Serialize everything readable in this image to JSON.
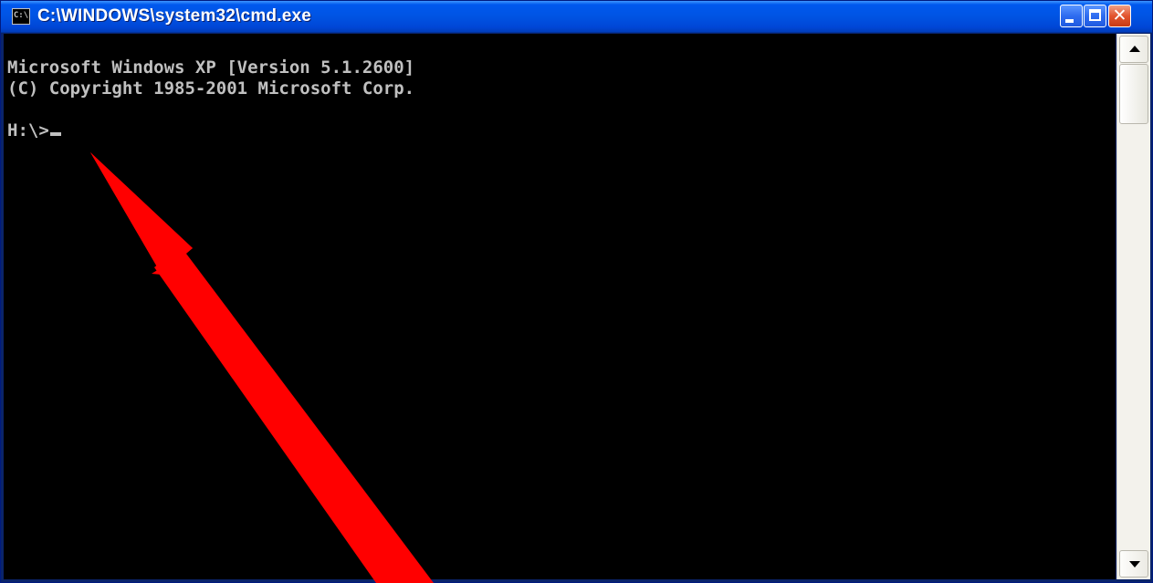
{
  "window": {
    "title": "C:\\WINDOWS\\system32\\cmd.exe",
    "icon_label": "C:\\"
  },
  "console": {
    "lines": [
      "Microsoft Windows XP [Version 5.1.2600]",
      "(C) Copyright 1985-2001 Microsoft Corp.",
      "H:\\>"
    ]
  },
  "colors": {
    "titlebar": "#0054e3",
    "console_bg": "#000000",
    "console_text": "#c0c0c0",
    "close_button": "#e2542e",
    "annotation_arrow": "#ff0000"
  },
  "icons": {
    "window_icon": "cmd-icon",
    "minimize": "minimize-icon",
    "maximize": "maximize-icon",
    "close": "close-icon",
    "scroll_up": "arrow-up-icon",
    "scroll_down": "arrow-down-icon",
    "annotation": "red-arrow-icon"
  },
  "scrollbar": {
    "position": 0
  }
}
